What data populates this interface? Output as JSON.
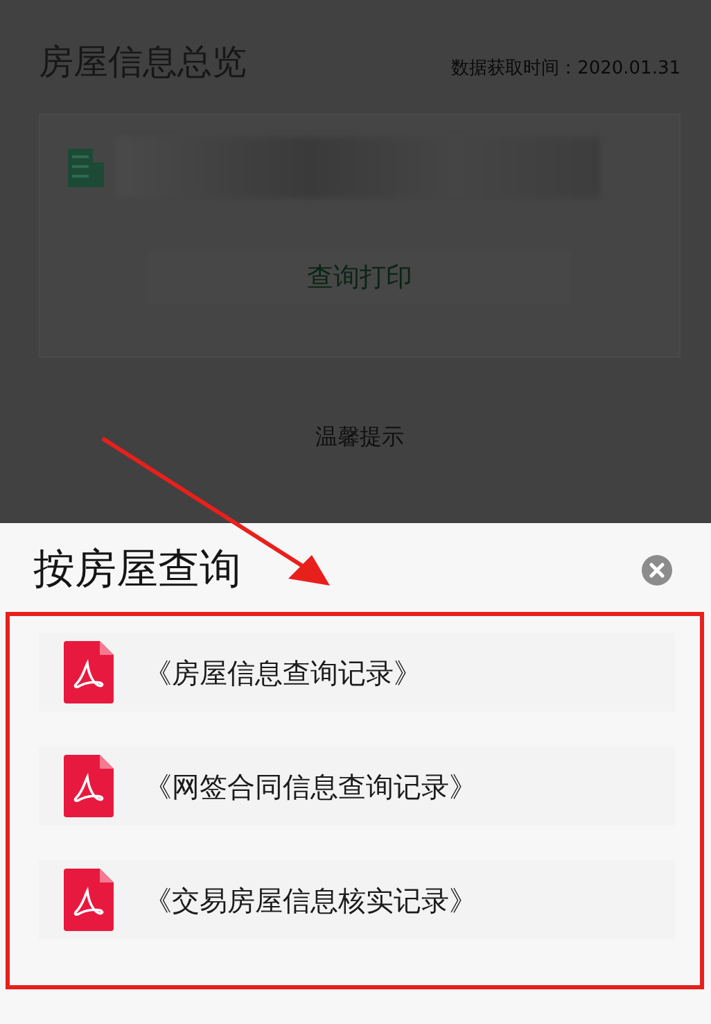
{
  "page": {
    "title": "房屋信息总览",
    "data_time": "数据获取时间：2020.01.31",
    "print_button": "查询打印",
    "tips_link": "温馨提示"
  },
  "sheet": {
    "title": "按房屋查询",
    "documents": [
      {
        "label": "《房屋信息查询记录》"
      },
      {
        "label": "《网签合同信息查询记录》"
      },
      {
        "label": "《交易房屋信息核实记录》"
      }
    ]
  }
}
